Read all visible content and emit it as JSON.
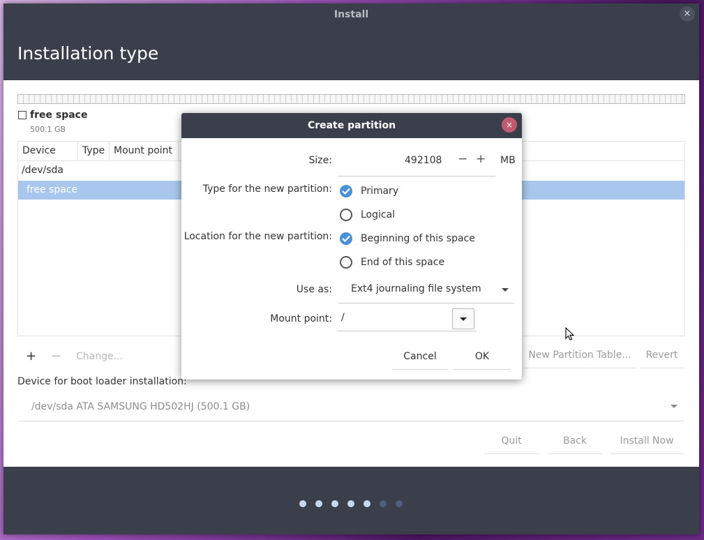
{
  "window": {
    "title": "Install",
    "close_glyph": "×"
  },
  "page_title": "Installation type",
  "disk_legend": {
    "name": "free space",
    "size": "500.1 GB"
  },
  "table": {
    "columns": [
      "Device",
      "Type",
      "Mount point"
    ],
    "rows": [
      {
        "device": "/dev/sda",
        "selected": false
      },
      {
        "device": "free space",
        "selected": true
      }
    ]
  },
  "toolbar": {
    "add": "+",
    "remove": "−",
    "change": "Change...",
    "new_table": "New Partition Table...",
    "revert": "Revert"
  },
  "bootloader": {
    "label": "Device for boot loader installation:",
    "value": "/dev/sda ATA SAMSUNG HD502HJ (500.1 GB)"
  },
  "nav": {
    "quit": "Quit",
    "back": "Back",
    "install": "Install Now"
  },
  "progress": {
    "total_steps": 7,
    "completed_steps": 5,
    "active_color": "#c7d8f0",
    "inactive_color": "#4f5f7d"
  },
  "dialog": {
    "title": "Create partition",
    "close_glyph": "×",
    "size_label": "Size:",
    "size_value": "492108",
    "size_unit": "MB",
    "minus": "−",
    "plus": "+",
    "type_label": "Type for the new partition:",
    "type_options": [
      {
        "label": "Primary",
        "checked": true
      },
      {
        "label": "Logical",
        "checked": false
      }
    ],
    "location_label": "Location for the new partition:",
    "location_options": [
      {
        "label": "Beginning of this space",
        "checked": true
      },
      {
        "label": "End of this space",
        "checked": false
      }
    ],
    "use_as_label": "Use as:",
    "use_as_value": "Ext4 journaling file system",
    "mount_label": "Mount point:",
    "mount_value": "/",
    "cancel": "Cancel",
    "ok": "OK"
  },
  "colors": {
    "header": "#3a3f4b",
    "accent": "#4a90d9",
    "selection": "#a9c7ec",
    "dialog_close": "#c25b6f"
  }
}
